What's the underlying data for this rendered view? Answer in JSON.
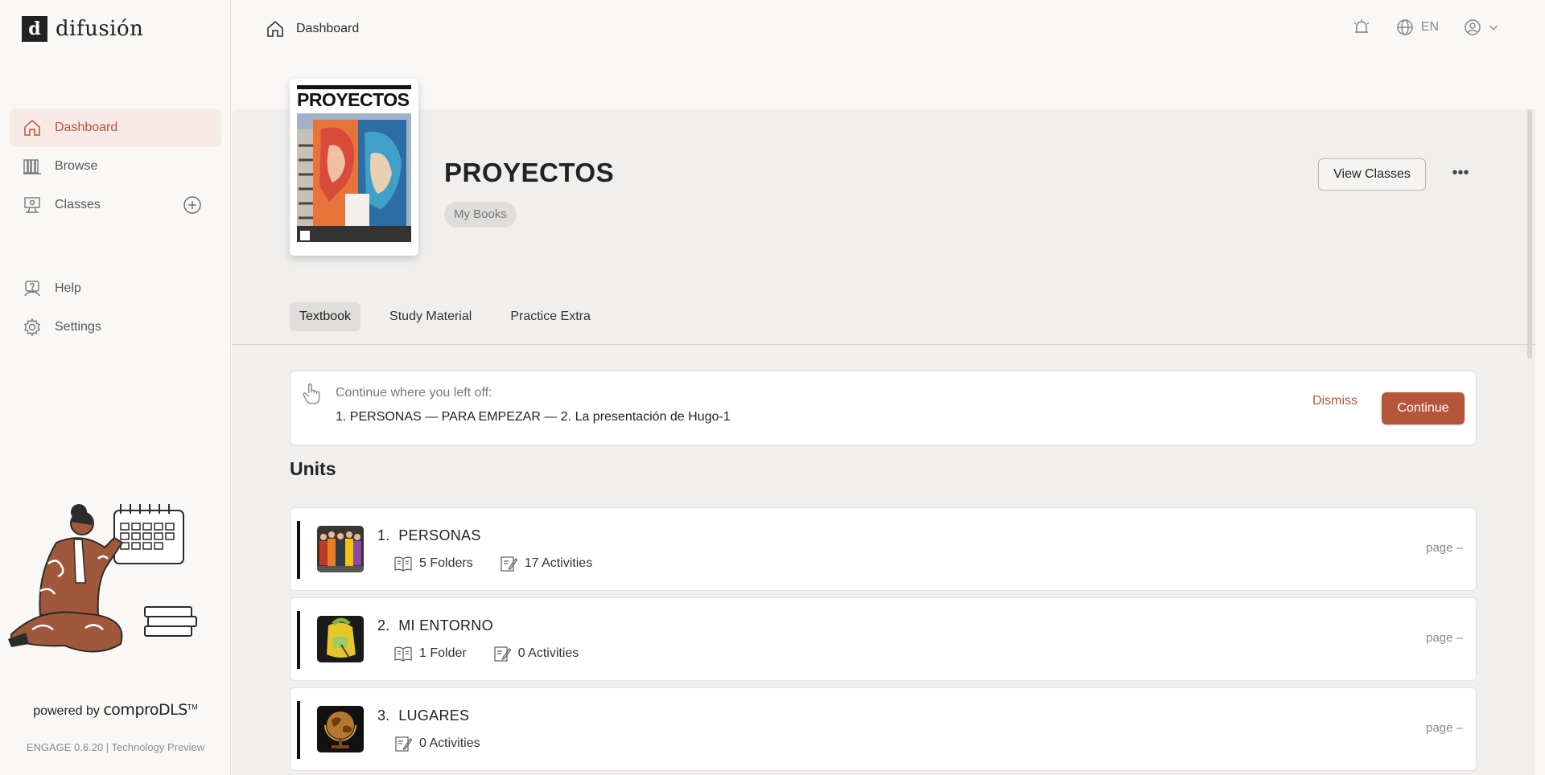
{
  "brand": {
    "logo_letter": "d",
    "name": "difusión"
  },
  "sidebar": {
    "items": [
      {
        "label": "Dashboard"
      },
      {
        "label": "Browse"
      },
      {
        "label": "Classes"
      },
      {
        "label": "Help"
      },
      {
        "label": "Settings"
      }
    ],
    "powered_prefix": "powered by",
    "powered_brand": "comproDLS",
    "powered_tm": "TM",
    "version": "ENGAGE 0.6.20 | Technology Preview"
  },
  "topbar": {
    "breadcrumb": "Dashboard",
    "language": "EN"
  },
  "book": {
    "cover_title": "PROYECTOS",
    "title": "PROYECTOS",
    "chip": "My Books",
    "view_classes": "View Classes",
    "more": "•••"
  },
  "tabs": [
    {
      "label": "Textbook",
      "active": true
    },
    {
      "label": "Study Material",
      "active": false
    },
    {
      "label": "Practice Extra",
      "active": false
    }
  ],
  "continue": {
    "label": "Continue where you left off:",
    "path": "1. PERSONAS — PARA EMPEZAR — 2. La presentación de Hugo-1",
    "dismiss": "Dismiss",
    "button": "Continue"
  },
  "units_heading": "Units",
  "units": [
    {
      "number": "1.",
      "name": "PERSONAS",
      "folders": "5 Folders",
      "activities": "17 Activities",
      "page": "page –"
    },
    {
      "number": "2.",
      "name": "MI ENTORNO",
      "folders": "1 Folder",
      "activities": "0 Activities",
      "page": "page –"
    },
    {
      "number": "3.",
      "name": "LUGARES",
      "folders": "",
      "activities": "0 Activities",
      "page": "page –"
    }
  ],
  "colors": {
    "accent": "#b5553a",
    "active_bg": "#f7e9e5"
  }
}
